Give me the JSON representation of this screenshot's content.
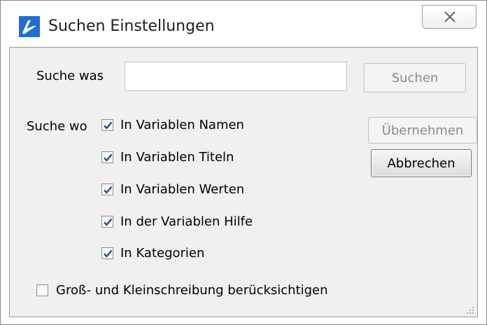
{
  "window": {
    "title": "Suchen Einstellungen",
    "app_icon": "brand-logo-icon",
    "close_icon": "close-icon"
  },
  "search": {
    "label": "Suche was",
    "value": "",
    "placeholder": ""
  },
  "buttons": {
    "search": "Suchen",
    "apply": "Übernehmen",
    "cancel": "Abbrechen"
  },
  "where": {
    "label": "Suche wo",
    "options": [
      {
        "label": "In Variablen Namen",
        "checked": true
      },
      {
        "label": "In Variablen Titeln",
        "checked": true
      },
      {
        "label": "In Variablen Werten",
        "checked": true
      },
      {
        "label": "In der Variablen Hilfe",
        "checked": true
      },
      {
        "label": "In Kategorien",
        "checked": true
      }
    ]
  },
  "case_sensitive": {
    "label": "Groß- und Kleinschreibung berücksichtigen",
    "checked": false
  },
  "colors": {
    "accent": "#1f6fd1",
    "check": "#2a4a8a",
    "client_bg": "#f0f0f0"
  }
}
